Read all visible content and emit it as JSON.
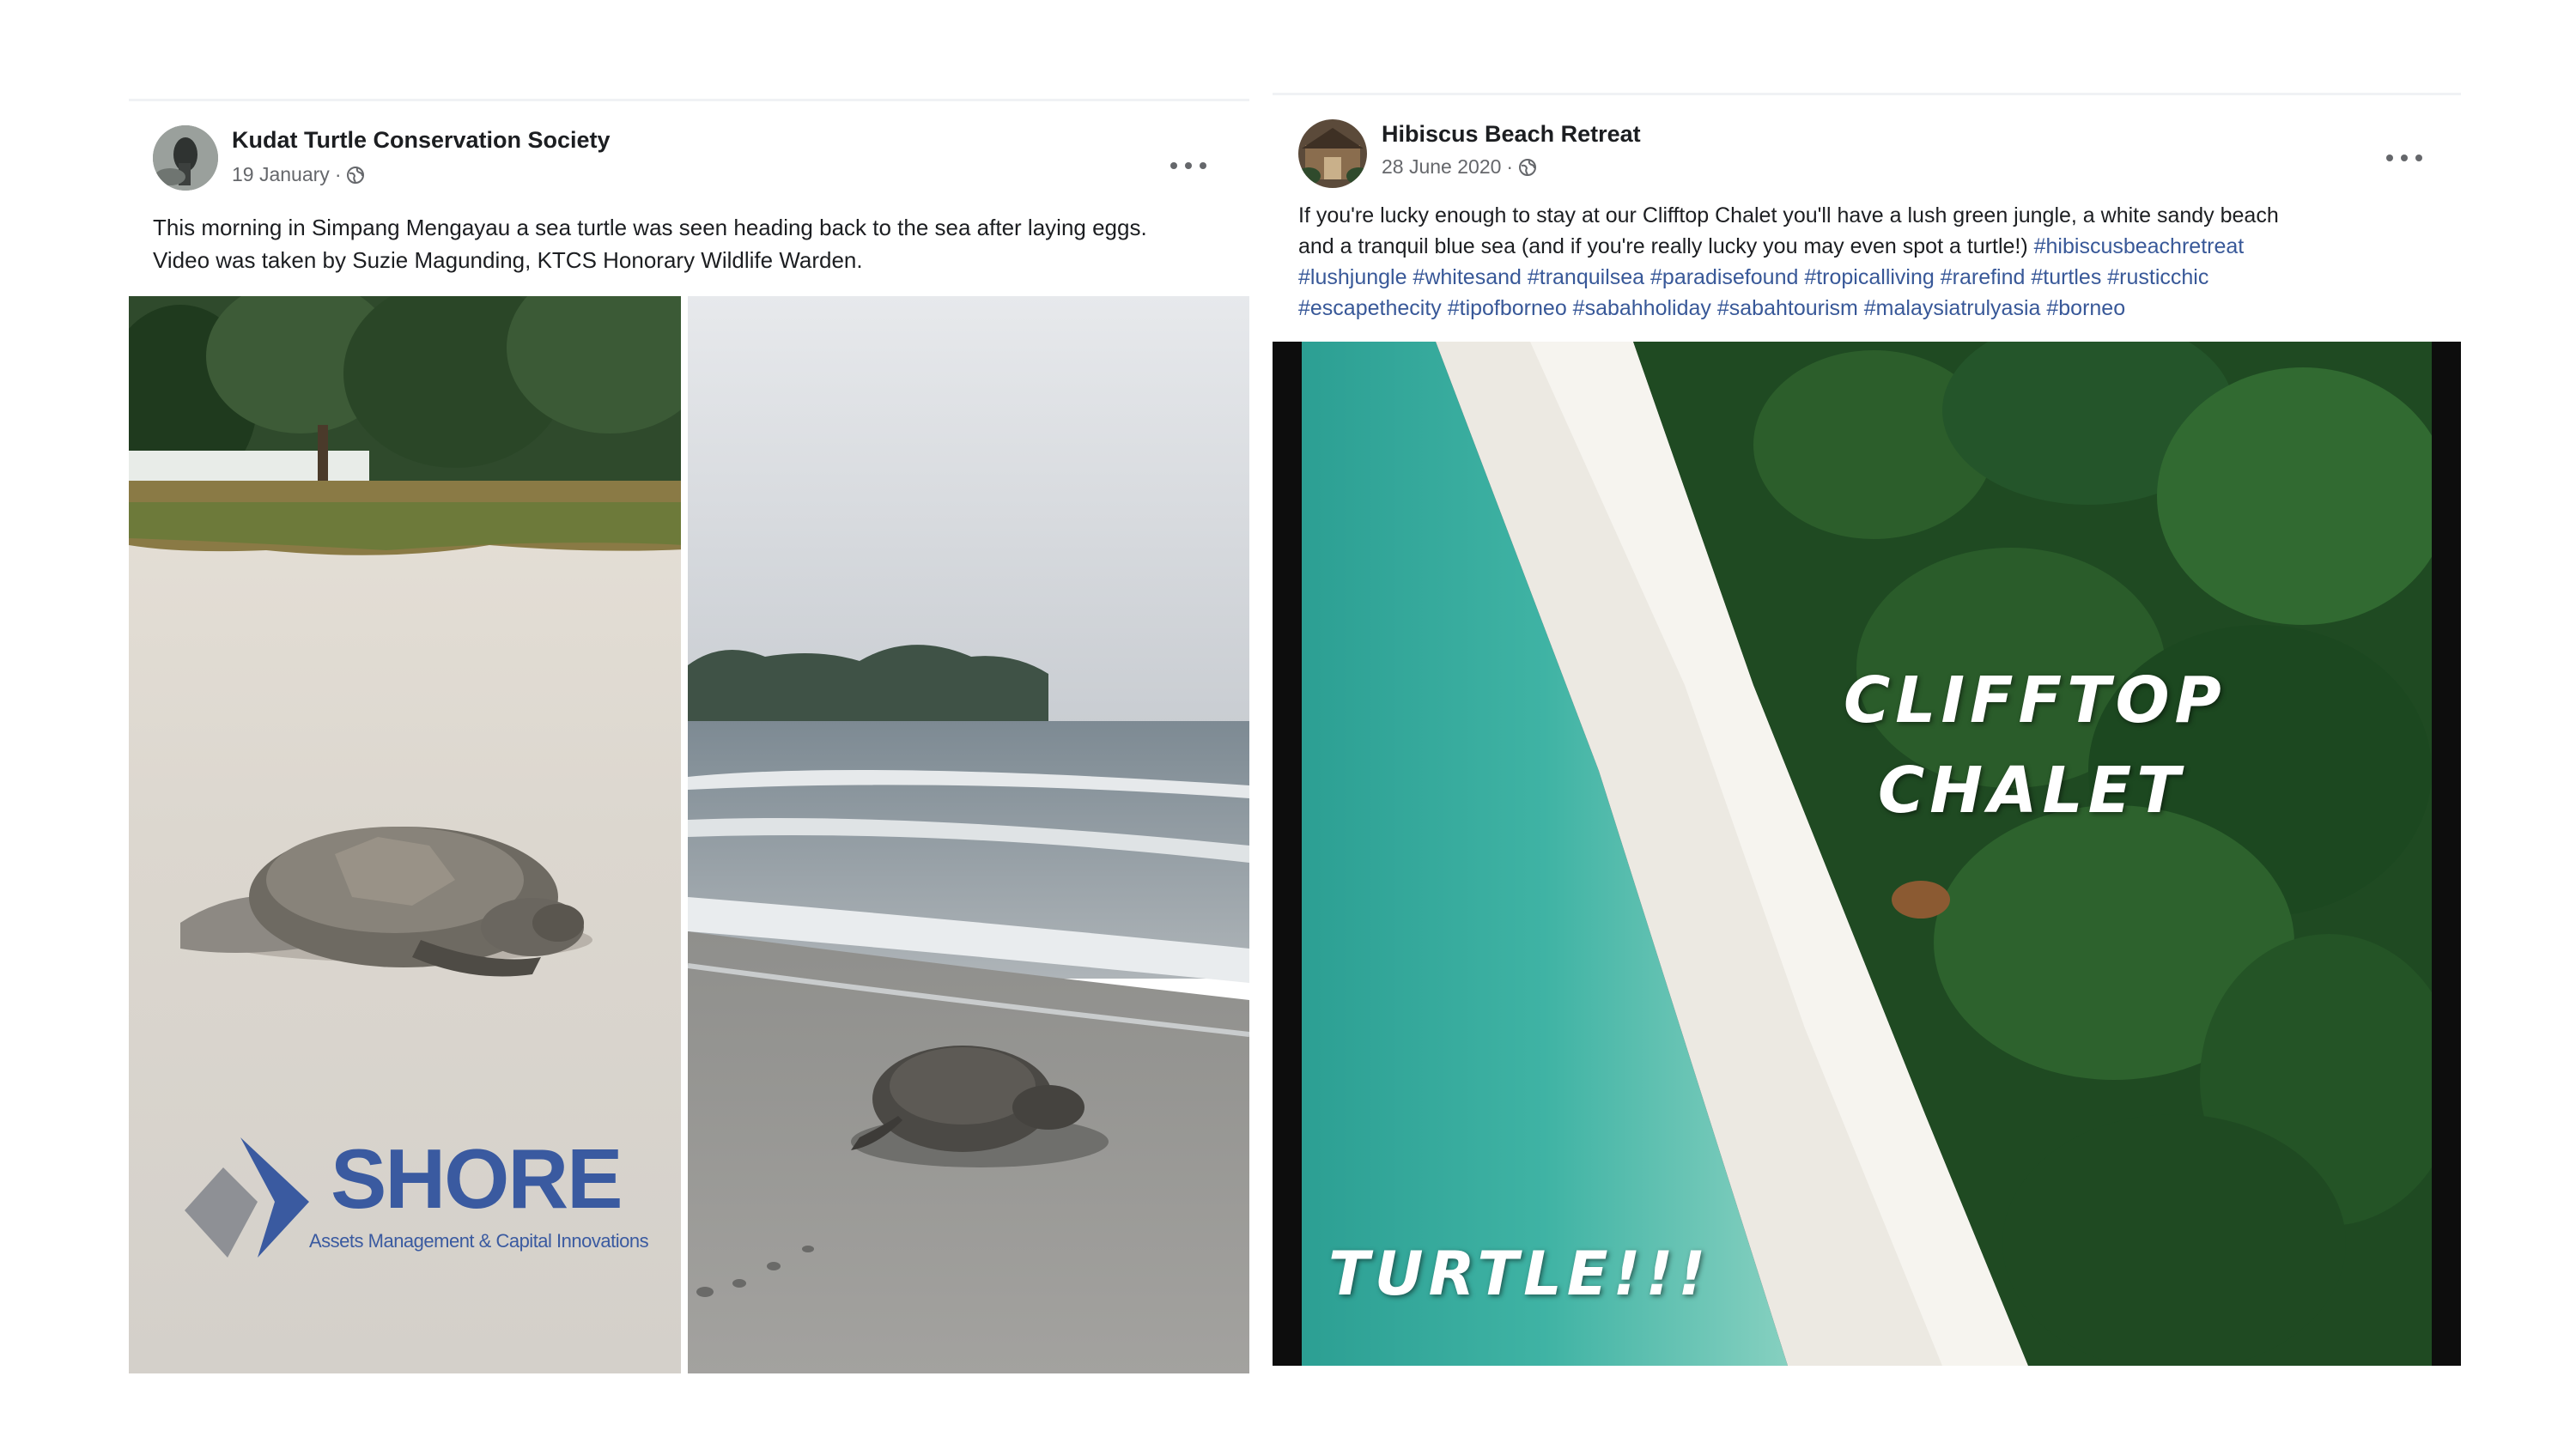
{
  "post1": {
    "author": "Kudat Turtle Conservation Society",
    "date": "19 January",
    "separator": "·",
    "privacy_icon": "globe-icon",
    "more_icon": "more-options-icon",
    "body_line1": "This morning in Simpang Mengayau a sea turtle was seen heading back to the sea after laying eggs.",
    "body_line2": "Video was taken by Suzie Magunding, KTCS Honorary Wildlife Warden.",
    "watermark": {
      "name": "SHORE",
      "tagline": "Assets Management & Capital Innovations"
    }
  },
  "post2": {
    "author": "Hibiscus Beach Retreat",
    "date": "28 June 2020",
    "separator": "·",
    "privacy_icon": "globe-icon",
    "more_icon": "more-options-icon",
    "body_line1": "If you're lucky enough to stay at our Clifftop Chalet you'll have a lush green jungle, a white sandy beach",
    "body_line2": "and a tranquil blue sea (and if you're really lucky you may even spot a turtle!)",
    "hashtags_line2": "#hibiscusbeachretreat",
    "hashtags_line3": "#lushjungle #whitesand #tranquilsea #paradisefound #tropicalliving #rarefind #turtles #rusticchic",
    "hashtags_line4": "#escapethecity #tipofborneo #sabahholiday #sabahtourism #malaysiatrulyasia #borneo",
    "overlay_line1": "CLIFFTOP",
    "overlay_line2": "CHALET",
    "overlay_bottom": "TURTLE!!!"
  },
  "colors": {
    "text": "#1c1e21",
    "meta": "#65676b",
    "link": "#385898",
    "brand_blue": "#3a5aa0"
  }
}
